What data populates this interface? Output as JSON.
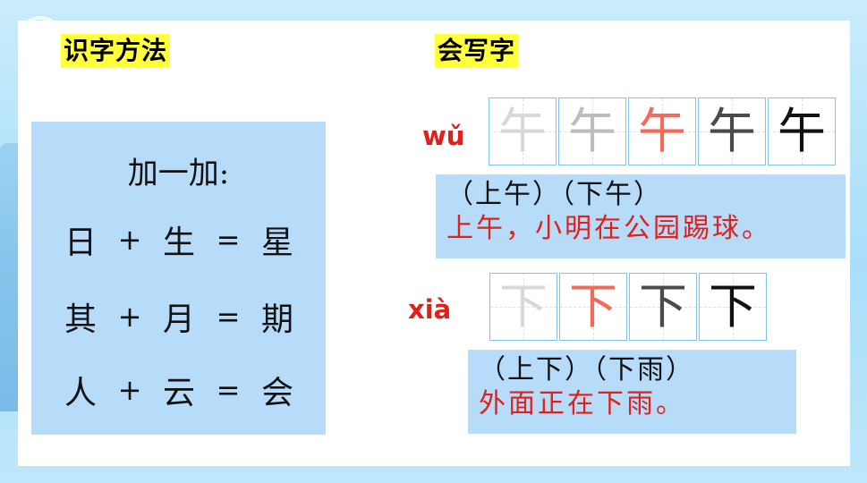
{
  "sections": {
    "left_tag": "识字方法",
    "right_tag": "会写字"
  },
  "equations": {
    "title": "加一加:",
    "rows": [
      {
        "a": "日",
        "op": "+",
        "b": "生",
        "eq": "=",
        "result": "星"
      },
      {
        "a": "其",
        "op": "+",
        "b": "月",
        "eq": "=",
        "result": "期"
      },
      {
        "a": "人",
        "op": "+",
        "b": "云",
        "eq": "=",
        "result": "会"
      }
    ]
  },
  "characters": [
    {
      "pinyin": "wǔ",
      "stroke_steps": [
        "午",
        "午",
        "午",
        "午",
        "午"
      ],
      "words": "（上午）（下午）",
      "sentence": "上午，小明在公园踢球。"
    },
    {
      "pinyin": "xià",
      "stroke_steps": [
        "下",
        "下",
        "下",
        "下"
      ],
      "words": "（上下）（下雨）",
      "sentence": "外面正在下雨。"
    }
  ],
  "colors": {
    "tag_bg": "#ffff3a",
    "panel_bg": "#b7dcfa",
    "accent_red": "#e0201a"
  }
}
